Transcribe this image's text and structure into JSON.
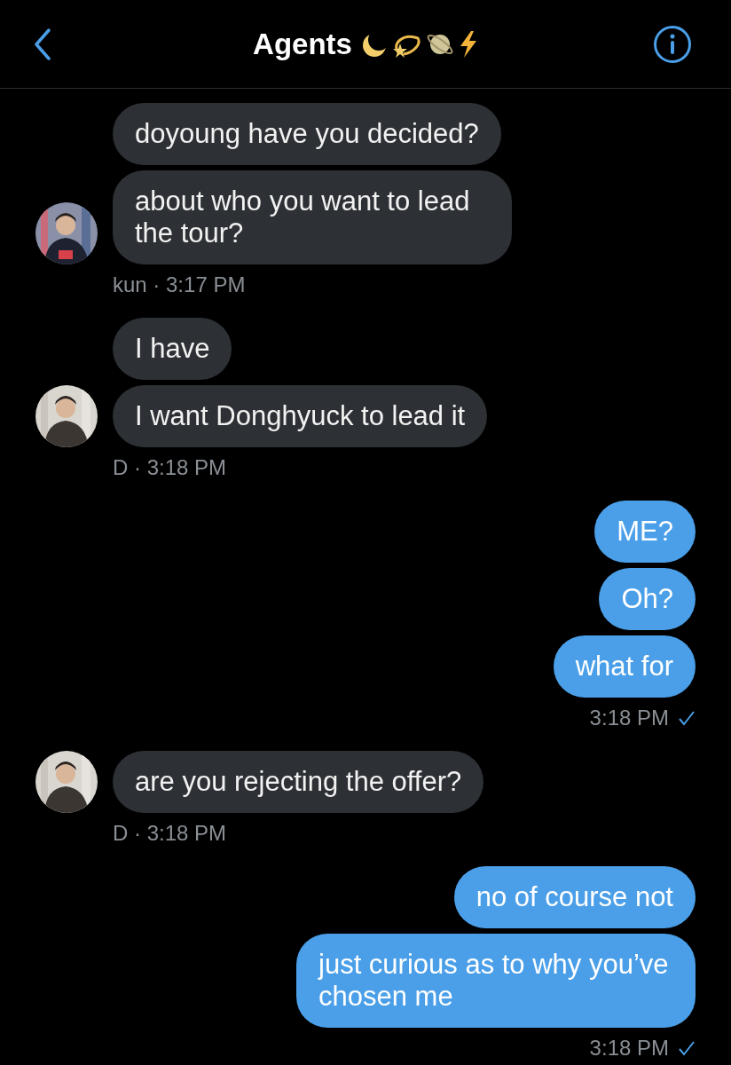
{
  "header": {
    "title": "Agents"
  },
  "groups": [
    {
      "kind": "incoming",
      "avatar": {
        "kind": "picture"
      },
      "messages": [
        "doyoung have you decided?",
        "about who you want to lead the tour?"
      ],
      "sender": "kun",
      "separator": "·",
      "time": "3:17 PM"
    },
    {
      "kind": "incoming",
      "avatar": {
        "kind": "picture"
      },
      "messages": [
        "I have",
        "I want Donghyuck to lead it"
      ],
      "sender": "D",
      "separator": "·",
      "time": "3:18 PM"
    },
    {
      "kind": "outgoing",
      "messages": [
        "ME?",
        "Oh?",
        "what for"
      ],
      "time": "3:18 PM",
      "read": true
    },
    {
      "kind": "incoming",
      "avatar": {
        "kind": "picture"
      },
      "messages": [
        "are you rejecting the offer?"
      ],
      "sender": "D",
      "separator": "·",
      "time": "3:18 PM"
    },
    {
      "kind": "outgoing",
      "messages": [
        "no of course not",
        "just curious as to why you’ve chosen me"
      ],
      "time": "3:18 PM",
      "read": true
    }
  ]
}
